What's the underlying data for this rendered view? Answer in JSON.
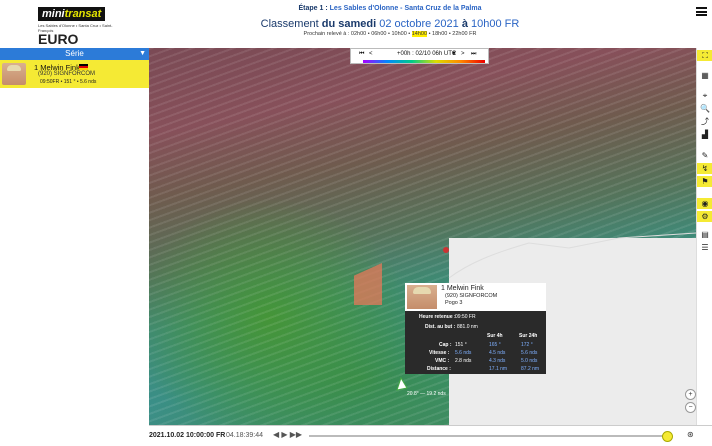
{
  "header": {
    "logo_mini": "mini",
    "logo_transat": "transat",
    "logo_tagline": "Les Sables d'Olonne • Santa Cruz • Saint-François",
    "logo_euro": "EURO CHEF",
    "stage_prefix": "Étape 1 :",
    "stage_route": "Les Sables d'Olonne - Santa Cruz de la Palma",
    "ranking_prefix": "Classement",
    "ranking_day": "du samedi",
    "ranking_date": "02 octobre 2021",
    "ranking_at": "à",
    "ranking_time": "10h00 FR",
    "next_label": "Prochain relevé à : 02h00 • 06h00 • 10h00 •",
    "next_highlight": "14h00",
    "next_rest": "• 18h00 • 22h00 FR"
  },
  "sidebar": {
    "series_label": "Série",
    "boat": {
      "rank_name": "1 Melwin Fink",
      "sail": "(920) SIGNFORCOM",
      "meta": "09:50FR • 151 ° • 5.6 nds"
    }
  },
  "map_control": {
    "prev_prev": "⏮",
    "prev": "<",
    "time_label": "+00h : 02/10 06h UTC",
    "dropdown": "▼",
    "next": ">",
    "next_next": "⏭"
  },
  "popup": {
    "name": "1  Melwin Fink",
    "sail": "(920) SIGNFORCOM",
    "pos": "Pogo 3",
    "heure_label": "Heure retenue :",
    "heure_value": "09:50 FR",
    "dist_label": "Dist. au but :",
    "dist_value": "881.0 nm",
    "col_4h": "Sur 4h",
    "col_24h": "Sur 24h",
    "rows": [
      {
        "label": "Cap :",
        "now": "151 °",
        "h4": "165 °",
        "h24": "172 °"
      },
      {
        "label": "Vitesse :",
        "now": "5.6 nds",
        "h4": "4.5 nds",
        "h24": "5.6 nds"
      },
      {
        "label": "VMC :",
        "now": "2.8 nds",
        "h4": "4.3 nds",
        "h24": "5.0 nds"
      },
      {
        "label": "Distance :",
        "now": "",
        "h4": "17.1 nm",
        "h24": "87.2 nm"
      }
    ]
  },
  "map_label": "20.8° — 19.2 nds",
  "bottom": {
    "date_start": "2021.10.02 10:00:00 FR",
    "elapsed": "04.18:39:44"
  }
}
